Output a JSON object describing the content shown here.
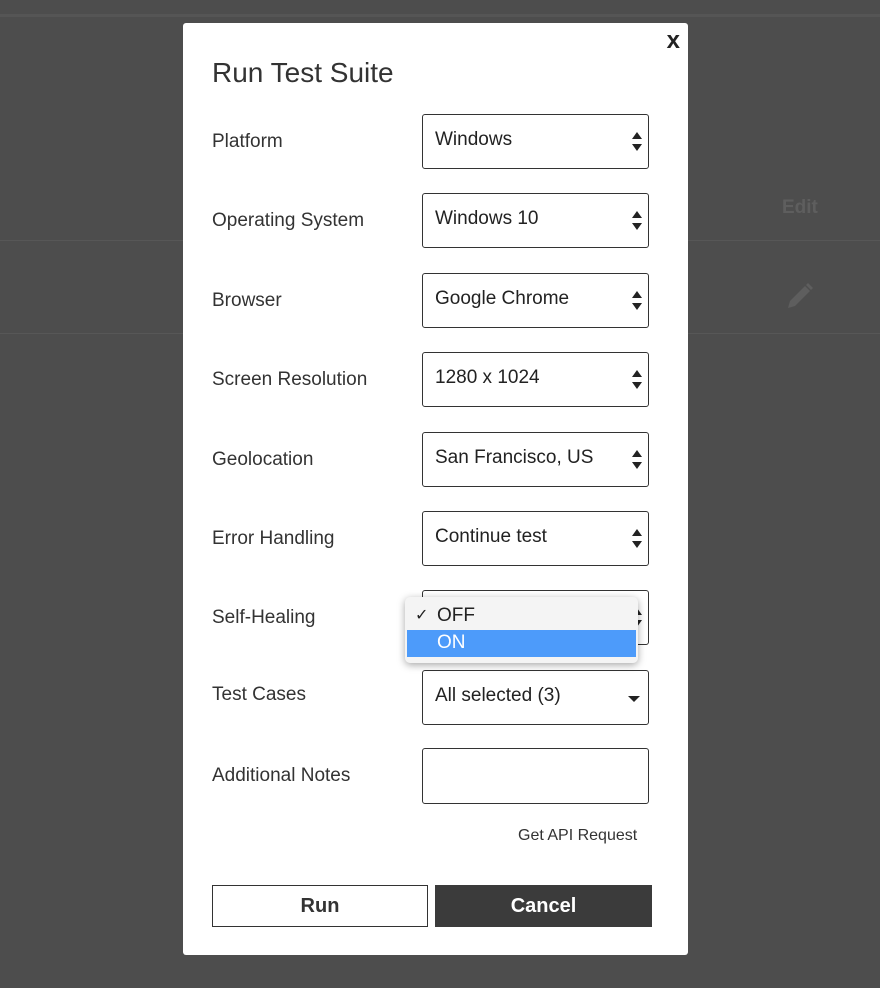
{
  "background": {
    "column_header": "Edit",
    "edit_icon": "pencil-icon"
  },
  "modal": {
    "title": "Run Test Suite",
    "close_label": "x",
    "fields": {
      "platform": {
        "label": "Platform",
        "value": "Windows"
      },
      "os": {
        "label": "Operating System",
        "value": "Windows 10"
      },
      "browser": {
        "label": "Browser",
        "value": "Google Chrome"
      },
      "resolution": {
        "label": "Screen Resolution",
        "value": "1280 x 1024"
      },
      "geolocation": {
        "label": "Geolocation",
        "value": "San Francisco, US"
      },
      "error_handling": {
        "label": "Error Handling",
        "value": "Continue test"
      },
      "self_healing": {
        "label": "Self-Healing",
        "value": "OFF",
        "options": [
          "OFF",
          "ON"
        ],
        "highlighted": "ON"
      },
      "test_cases": {
        "label": "Test Cases",
        "value": "All selected (3)"
      },
      "notes": {
        "label": "Additional Notes",
        "value": ""
      }
    },
    "api_link": "Get API Request",
    "run_label": "Run",
    "cancel_label": "Cancel"
  },
  "colors": {
    "overlay": "#4d4d4d",
    "highlight": "#4d9bfa",
    "cancel_bg": "#3b3b3b"
  }
}
